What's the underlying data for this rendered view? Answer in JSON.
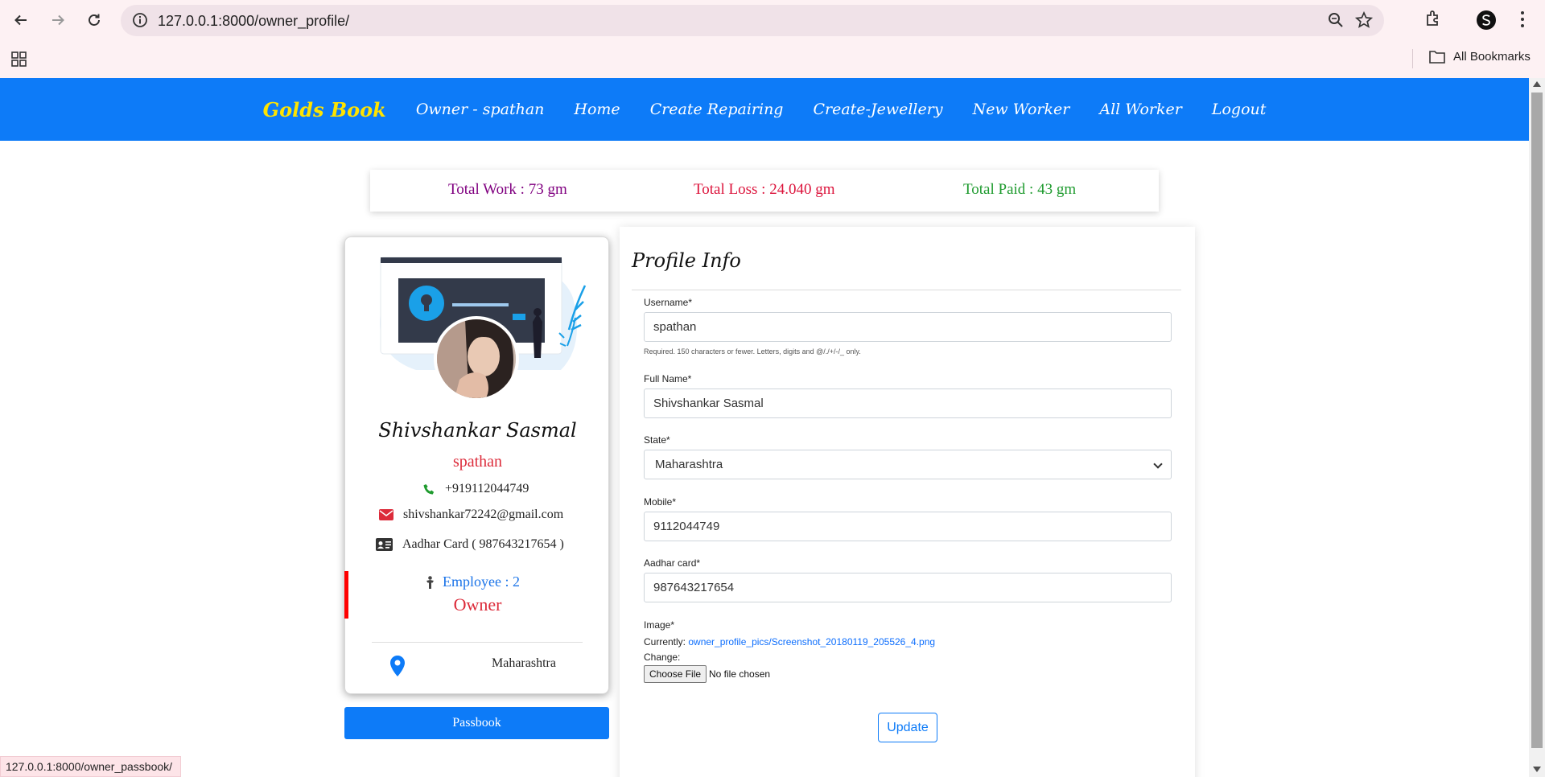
{
  "browser": {
    "url": "127.0.0.1:8000/owner_profile/",
    "bookmarks_label": "All Bookmarks",
    "status_url": "127.0.0.1:8000/owner_passbook/"
  },
  "nav": {
    "brand": "Golds Book",
    "links": [
      "Owner - spathan",
      "Home",
      "Create Repairing",
      "Create-Jewellery",
      "New Worker",
      "All Worker",
      "Logout"
    ]
  },
  "stats": {
    "total_work": "Total Work : 73 gm",
    "total_loss": "Total Loss : 24.040 gm",
    "total_paid": "Total Paid : 43 gm"
  },
  "card": {
    "name": "Shivshankar Sasmal",
    "username": "spathan",
    "phone": "+919112044749",
    "email": "shivshankar72242@gmail.com",
    "aadhar": "Aadhar Card ( 987643217654 )",
    "employee": "Employee : 2",
    "role": "Owner",
    "location": "Maharashtra",
    "passbook_label": "Passbook"
  },
  "form": {
    "title": "Profile Info",
    "username_label": "Username*",
    "username_value": "spathan",
    "username_help": "Required. 150 characters or fewer. Letters, digits and @/./+/-/_ only.",
    "fullname_label": "Full Name*",
    "fullname_value": "Shivshankar Sasmal",
    "state_label": "State*",
    "state_value": "Maharashtra",
    "mobile_label": "Mobile*",
    "mobile_value": "9112044749",
    "aadhar_label": "Aadhar card*",
    "aadhar_value": "987643217654",
    "image_label": "Image*",
    "currently_label": "Currently:",
    "currently_link": "owner_profile_pics/Screenshot_20180119_205526_4.png",
    "change_label": "Change:",
    "choose_file_label": "Choose File",
    "no_file_label": "No file chosen",
    "update_label": "Update"
  },
  "colors": {
    "nav_bg": "#0d7bf8",
    "brand": "#ffe400",
    "work": "#800080",
    "loss": "#dc143c",
    "paid": "#1f9b2f"
  }
}
